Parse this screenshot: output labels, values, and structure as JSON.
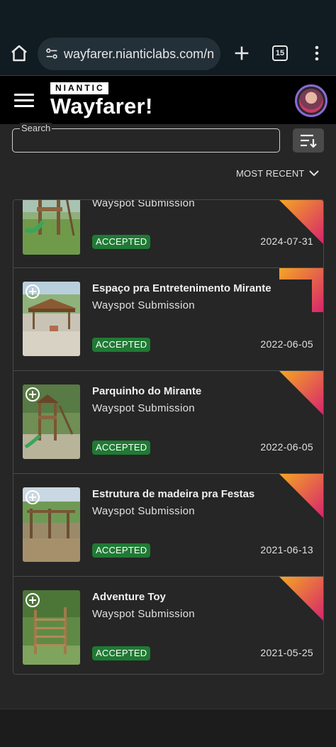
{
  "browser": {
    "url": "wayfarer.nianticlabs.com/n",
    "tab_count": "15",
    "icons": [
      "home-icon",
      "site-settings-icon",
      "new-tab-icon",
      "tabs-icon",
      "more-vert-icon"
    ]
  },
  "header": {
    "brand_badge": "NIANTIC",
    "brand_name": "Wayfarer",
    "brand_mark": "!"
  },
  "search": {
    "label": "Search",
    "value": ""
  },
  "sort": {
    "selected": "MOST RECENT"
  },
  "colors": {
    "accepted_badge": "#1f7a34",
    "corner_gradient_start": "#f5a623",
    "corner_gradient_end": "#d6246e",
    "avatar_ring": "#8a6ad8"
  },
  "submissions": [
    {
      "title": "",
      "type": "Wayspot Submission",
      "status": "ACCEPTED",
      "date": "2024-07-31"
    },
    {
      "title": "Espaço pra Entretenimento Mirante",
      "type": "Wayspot Submission",
      "status": "ACCEPTED",
      "date": "2022-06-05"
    },
    {
      "title": "Parquinho do Mirante",
      "type": "Wayspot Submission",
      "status": "ACCEPTED",
      "date": "2022-06-05"
    },
    {
      "title": "Estrutura de madeira pra Festas",
      "type": "Wayspot Submission",
      "status": "ACCEPTED",
      "date": "2021-06-13"
    },
    {
      "title": "Adventure Toy",
      "type": "Wayspot Submission",
      "status": "ACCEPTED",
      "date": "2021-05-25"
    }
  ]
}
